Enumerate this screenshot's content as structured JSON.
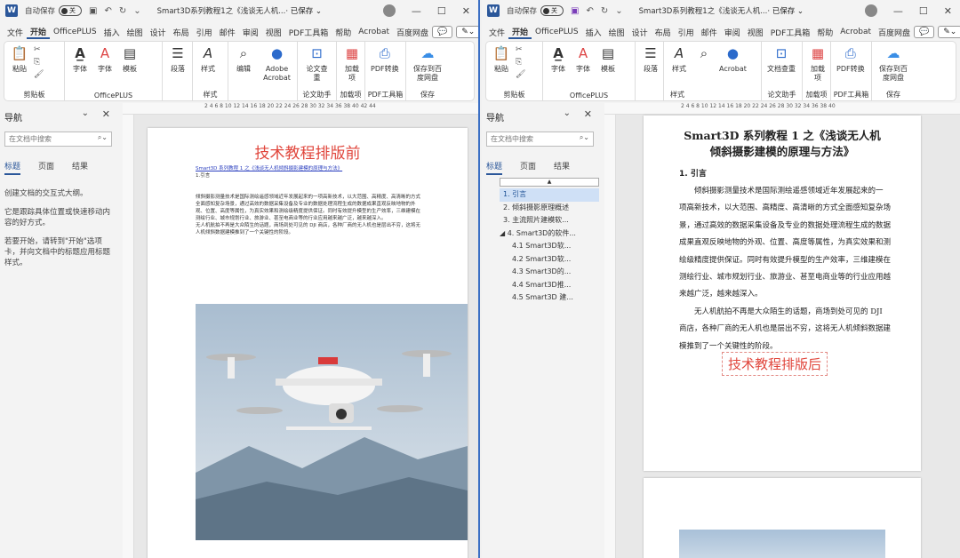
{
  "left": {
    "autosave": "自动保存",
    "toggle": "关",
    "doc_title": "Smart3D系列教程1之《浅谈无人机...",
    "saved": "· 已保存 ⌄",
    "menu": [
      "文件",
      "开始",
      "OfficePLUS",
      "插入",
      "绘图",
      "设计",
      "布局",
      "引用",
      "邮件",
      "审阅",
      "视图",
      "PDF工具箱",
      "帮助",
      "Acrobat",
      "百度网盘"
    ],
    "ribbon": {
      "paste": "粘贴",
      "clipboard_group": "剪贴板",
      "font": "字体",
      "font2": "字体",
      "template": "模板",
      "officeplus_group": "OfficePLUS",
      "paragraph": "段落",
      "styles": "样式",
      "styles_group": "样式",
      "edit": "编辑",
      "adobe": "Adobe Acrobat",
      "compare": "论文查重",
      "thesis_group": "论文助手",
      "addin": "加载项",
      "addin_group": "加载项",
      "pdf": "PDF转换",
      "pdf_group": "PDF工具箱",
      "save_baidu": "保存到百度网盘",
      "save_group": "保存"
    },
    "nav": {
      "title": "导航",
      "search_placeholder": "在文档中搜索",
      "tabs": [
        "标题",
        "页面",
        "结果"
      ],
      "msg1": "创建文档的交互式大纲。",
      "msg2": "它是跟踪具体位置或快速移动内容的好方式。",
      "msg3": "若要开始，请转到\"开始\"选项卡，并向文档中的标题应用标题样式。"
    },
    "page": {
      "overlay": "技术教程排版前",
      "link": "Smart3D 系列教程 1 之《浅谈无人机倾斜摄影建模的原理与方法》",
      "h1": "1.引言",
      "p1": "倾斜摄影测量技术是国际测绘遥感领域近年发展起来的一项高新技术，以大范围、高精度、高清晰的方式全面感知复杂场景，通过高效的数据采集设备及专业的数据处理流程生成的数据成果直观反映地物的外观、位置、高度等属性，为真实效果和测绘级精度提供保证。同时有效提升模型的生产效率，三维建模在测绘行业、城市规划行业、旅游业、甚至电商业等的行业应用越来越广泛，越来越深入。",
      "p2": "无人机航拍不再是大众陌生的话题，商场到处可见的 DJI 商店，各种厂商的无人机也是层出不穷，这将无人机倾斜数据建模推到了一个关键性的阶段。"
    },
    "ruler": "2  4  6  8  10  12  14  16  18  20  22  24  26  28  30  32  34  36  38  40  42  44"
  },
  "right": {
    "autosave": "自动保存",
    "toggle": "关",
    "doc_title": "Smart3D系列教程1之《浅谈无人机...",
    "saved": "· 已保存 ⌄",
    "menu": [
      "文件",
      "开始",
      "OfficePLUS",
      "插入",
      "绘图",
      "设计",
      "布局",
      "引用",
      "邮件",
      "审阅",
      "视图",
      "PDF工具箱",
      "帮助",
      "Acrobat",
      "百度网盘"
    ],
    "ribbon": {
      "paste": "粘贴",
      "clipboard_group": "剪贴板",
      "font": "字体",
      "font2": "字体",
      "template": "模板",
      "officeplus_group": "OfficePLUS",
      "paragraph": "段落",
      "styles": "样式",
      "styles_group": "样式",
      "adobe": "Acrobat",
      "compare": "文档查重",
      "thesis_group": "论文助手",
      "addin": "加载项",
      "addin_group": "加载项",
      "pdf": "PDF转换",
      "pdf_group": "PDF工具箱",
      "save_baidu": "保存到百度网盘",
      "save_group": "保存"
    },
    "ime": "五",
    "nav": {
      "title": "导航",
      "search_placeholder": "在文档中搜索",
      "tabs": [
        "标题",
        "页面",
        "结果"
      ],
      "headings": [
        "1. 引言",
        "2. 倾斜摄影原理概述",
        "3. 主流照片建模软...",
        "4. Smart3D的软件...",
        "4.1 Smart3D软...",
        "4.2 Smart3D软...",
        "4.3 Smart3D的...",
        "4.4 Smart3D推...",
        "4.5 Smart3D 建..."
      ]
    },
    "page": {
      "title_line1": "Smart3D 系列教程 1 之《浅谈无人机",
      "title_line2": "倾斜摄影建模的原理与方法》",
      "h1": "1. 引言",
      "lines": [
        "倾斜摄影测量技术是国际测绘遥感领域近年发展起来的一",
        "项高新技术，以大范围、高精度、高清晰的方式全面感知复杂场",
        "景，通过高效的数据采集设备及专业的数据处理流程生成的数据",
        "成果直观反映地物的外观、位置、高度等属性，为真实效果和测",
        "绘级精度提供保证。同时有效提升模型的生产效率，三维建模在",
        "测绘行业、城市规划行业、旅游业、甚至电商业等的行业应用越",
        "来越广泛，越来越深入。",
        "无人机航拍不再是大众陌生的话题，商场到处可见的 DJI",
        "商店，各种厂商的无人机也是层出不穷，这将无人机倾斜数据建",
        "模推到了一个关键性的阶段。"
      ],
      "overlay": "技术教程排版后"
    },
    "ruler": "2  4  6  8  10  12  14  16  18  20  22  24  26  28  30  32  34  36  38  40"
  },
  "colors": {
    "accent": "#2b579a",
    "overlay_red": "#e0463c",
    "selected": "#cfe0f6"
  }
}
